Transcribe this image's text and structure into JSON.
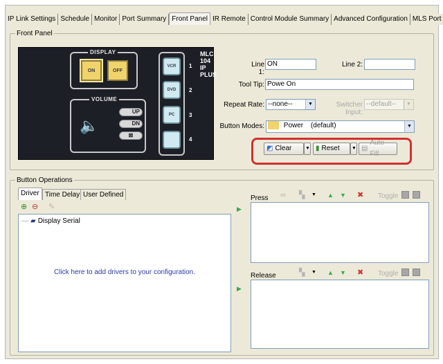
{
  "tabs": [
    {
      "label": "IP Link Settings",
      "active": false
    },
    {
      "label": "Schedule",
      "active": false
    },
    {
      "label": "Monitor",
      "active": false
    },
    {
      "label": "Port Summary",
      "active": false
    },
    {
      "label": "Front Panel",
      "active": true
    },
    {
      "label": "IR Remote",
      "active": false
    },
    {
      "label": "Control Module Summary",
      "active": false
    },
    {
      "label": "Advanced Configuration",
      "active": false
    },
    {
      "label": "MLS Port",
      "active": false
    }
  ],
  "front_panel": {
    "group_label": "Front Panel",
    "device": {
      "model_line1": "MLC 104",
      "model_line2": "IP PLUS",
      "display_title": "DISPLAY",
      "on_label": "ON",
      "off_label": "OFF",
      "volume_title": "VOLUME",
      "vol_up": "UP",
      "vol_dn": "DN",
      "sources": [
        {
          "label": "VCR",
          "num": "1"
        },
        {
          "label": "DVD",
          "num": "2"
        },
        {
          "label": "PC",
          "num": "3"
        },
        {
          "label": "",
          "num": "4"
        }
      ]
    },
    "line1_label": "Line 1:",
    "line1_value": "ON",
    "line2_label": "Line 2:",
    "line2_value": "",
    "tooltip_label": "Tool Tip:",
    "tooltip_value": "Powe On",
    "repeat_label": "Repeat Rate:",
    "repeat_value": "--none--",
    "switcher_label": "Switcher Input:",
    "switcher_value": "--default--",
    "button_modes_label": "Button Modes:",
    "button_mode_value": "Power",
    "button_mode_suffix": "(default)",
    "clear_label": "Clear",
    "reset_label": "Reset",
    "autofill_label": "Auto Fill"
  },
  "button_operations": {
    "group_label": "Button Operations",
    "subtabs": [
      {
        "label": "Driver",
        "active": true
      },
      {
        "label": "Time Delay",
        "active": false
      },
      {
        "label": "User Defined",
        "active": false
      }
    ],
    "tree_item": "Display Serial",
    "hint": "Click here to add drivers to your configuration.",
    "press_label": "Press",
    "release_label": "Release",
    "toggle_label": "Toggle"
  },
  "colors": {
    "highlight": "#d0312d",
    "hint_text": "#2a3aa8",
    "yellow_button": "#f1d36b"
  }
}
